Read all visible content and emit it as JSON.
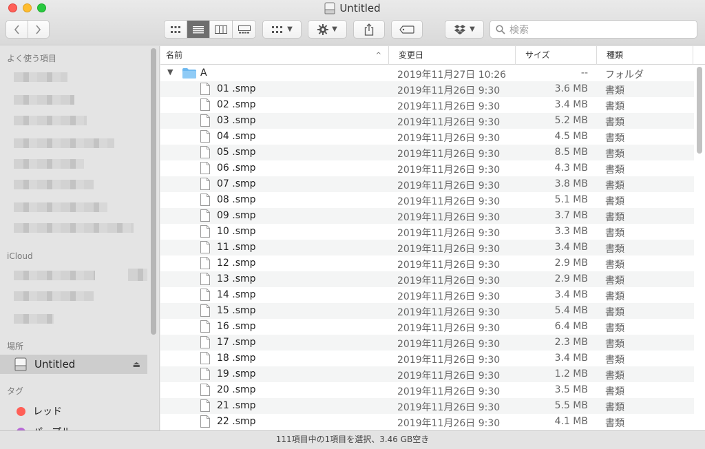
{
  "window": {
    "title": "Untitled"
  },
  "toolbar": {
    "search_placeholder": "検索"
  },
  "sidebar": {
    "favorites_header": "よく使う項目",
    "icloud_header": "iCloud",
    "locations_header": "場所",
    "location_selected": "Untitled",
    "tags_header": "タグ",
    "tags": [
      {
        "label": "レッド",
        "color": "#ff5f57"
      },
      {
        "label": "パープル",
        "color": "#b86ad7"
      }
    ]
  },
  "columns": {
    "name": "名前",
    "date": "変更日",
    "size": "サイズ",
    "kind": "種類"
  },
  "folder_row": {
    "name": "A",
    "date": "2019年11月27日 10:26",
    "size": "--",
    "kind": "フォルダ"
  },
  "files": [
    {
      "name": "01 .smp",
      "date": "2019年11月26日 9:30",
      "size": "3.6 MB",
      "kind": "書類"
    },
    {
      "name": "02 .smp",
      "date": "2019年11月26日 9:30",
      "size": "3.4 MB",
      "kind": "書類"
    },
    {
      "name": "03 .smp",
      "date": "2019年11月26日 9:30",
      "size": "5.2 MB",
      "kind": "書類"
    },
    {
      "name": "04 .smp",
      "date": "2019年11月26日 9:30",
      "size": "4.5 MB",
      "kind": "書類"
    },
    {
      "name": "05 .smp",
      "date": "2019年11月26日 9:30",
      "size": "8.5 MB",
      "kind": "書類"
    },
    {
      "name": "06 .smp",
      "date": "2019年11月26日 9:30",
      "size": "4.3 MB",
      "kind": "書類"
    },
    {
      "name": "07 .smp",
      "date": "2019年11月26日 9:30",
      "size": "3.8 MB",
      "kind": "書類"
    },
    {
      "name": "08 .smp",
      "date": "2019年11月26日 9:30",
      "size": "5.1 MB",
      "kind": "書類"
    },
    {
      "name": "09 .smp",
      "date": "2019年11月26日 9:30",
      "size": "3.7 MB",
      "kind": "書類"
    },
    {
      "name": "10 .smp",
      "date": "2019年11月26日 9:30",
      "size": "3.3 MB",
      "kind": "書類"
    },
    {
      "name": "11 .smp",
      "date": "2019年11月26日 9:30",
      "size": "3.4 MB",
      "kind": "書類"
    },
    {
      "name": "12 .smp",
      "date": "2019年11月26日 9:30",
      "size": "2.9 MB",
      "kind": "書類"
    },
    {
      "name": "13 .smp",
      "date": "2019年11月26日 9:30",
      "size": "2.9 MB",
      "kind": "書類"
    },
    {
      "name": "14 .smp",
      "date": "2019年11月26日 9:30",
      "size": "3.4 MB",
      "kind": "書類"
    },
    {
      "name": "15 .smp",
      "date": "2019年11月26日 9:30",
      "size": "5.4 MB",
      "kind": "書類"
    },
    {
      "name": "16 .smp",
      "date": "2019年11月26日 9:30",
      "size": "6.4 MB",
      "kind": "書類"
    },
    {
      "name": "17 .smp",
      "date": "2019年11月26日 9:30",
      "size": "2.3 MB",
      "kind": "書類"
    },
    {
      "name": "18 .smp",
      "date": "2019年11月26日 9:30",
      "size": "3.4 MB",
      "kind": "書類"
    },
    {
      "name": "19 .smp",
      "date": "2019年11月26日 9:30",
      "size": "1.2 MB",
      "kind": "書類"
    },
    {
      "name": "20 .smp",
      "date": "2019年11月26日 9:30",
      "size": "3.5 MB",
      "kind": "書類"
    },
    {
      "name": "21 .smp",
      "date": "2019年11月26日 9:30",
      "size": "5.5 MB",
      "kind": "書類"
    },
    {
      "name": "22 .smp",
      "date": "2019年11月26日 9:30",
      "size": "4.1 MB",
      "kind": "書類"
    }
  ],
  "status_bar": {
    "text": "111項目中の1項目を選択、3.46 GB空き"
  },
  "icons": {
    "back": "chevron-left-icon",
    "forward": "chevron-right-icon",
    "views": [
      "icon-view-icon",
      "list-view-icon",
      "column-view-icon",
      "gallery-view-icon"
    ],
    "group": "group-icon",
    "action": "gear-icon",
    "share": "share-icon",
    "tag": "tag-icon",
    "dropbox": "dropbox-icon",
    "search": "search-icon"
  }
}
